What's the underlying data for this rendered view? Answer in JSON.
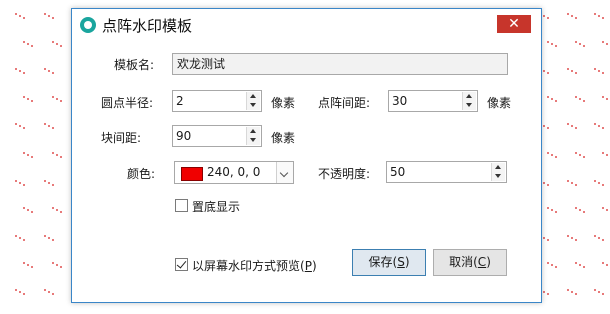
{
  "dialog": {
    "title": "点阵水印模板",
    "close_label": "✕"
  },
  "form": {
    "template_name_label": "模板名:",
    "template_name_value": "欢龙测试",
    "dot_radius_label": "圆点半径:",
    "dot_radius_value": "2",
    "dot_radius_unit": "像素",
    "dot_spacing_label": "点阵间距:",
    "dot_spacing_value": "30",
    "dot_spacing_unit": "像素",
    "block_spacing_label": "块间距:",
    "block_spacing_value": "90",
    "block_spacing_unit": "像素",
    "color_label": "颜色:",
    "color_value": "240, 0, 0",
    "color_swatch": "#f00000",
    "opacity_label": "不透明度:",
    "opacity_value": "50",
    "on_bottom_label": "置底显示",
    "on_bottom_checked": false,
    "preview_label_main": "以屏幕水印方式预览(",
    "preview_label_key": "P",
    "preview_label_end": ")",
    "preview_checked": true
  },
  "buttons": {
    "save_main": "保存(",
    "save_key": "S",
    "save_end": ")",
    "cancel_main": "取消(",
    "cancel_key": "C",
    "cancel_end": ")"
  },
  "colors": {
    "accent": "#3a86c8",
    "close_bg": "#c7352b",
    "dot": "#e05050",
    "app_icon": "#1aa59e"
  },
  "icons": {
    "app": "app-logo-icon",
    "close": "close-icon",
    "spin_up": "chevron-up-icon",
    "spin_down": "chevron-down-icon",
    "dropdown": "chevron-down-icon",
    "check": "check-icon"
  }
}
